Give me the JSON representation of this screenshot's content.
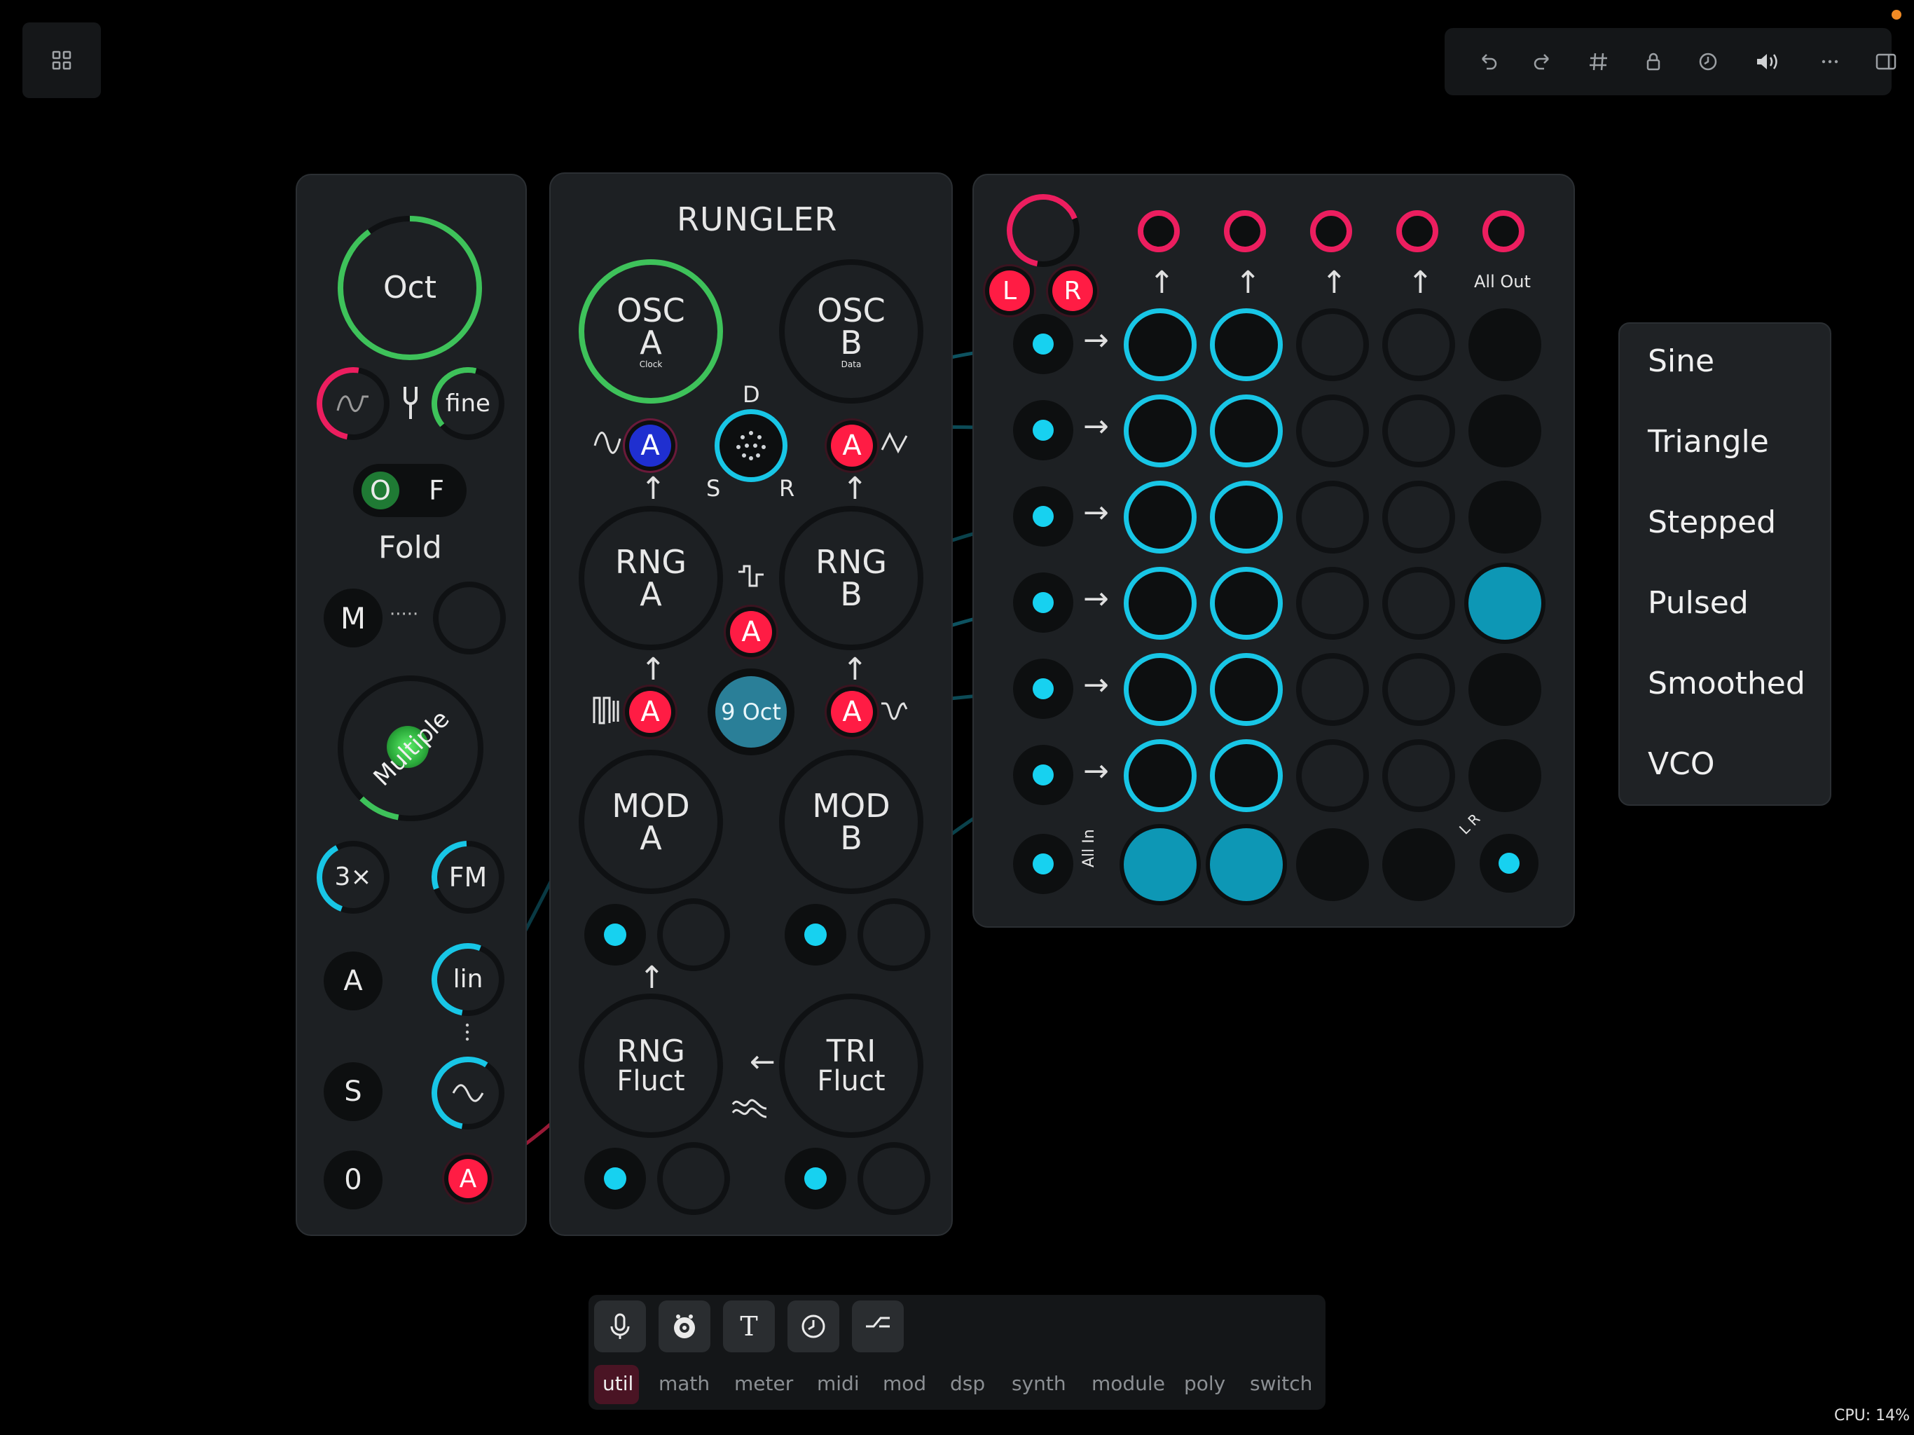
{
  "top_toolbar": {
    "icons": [
      "undo-icon",
      "redo-icon",
      "grid-icon",
      "lock-icon",
      "history-icon",
      "volume-icon",
      "more-icon",
      "sidebar-icon"
    ],
    "notification_color": "#f08a24"
  },
  "left_panel": {
    "oct_knob": "Oct",
    "fine_knob": "fine",
    "toggle_o": "O",
    "toggle_f": "F",
    "fold_label": "Fold",
    "m_button": "M",
    "dotted": "·····",
    "multiple_knob": "Multiple",
    "mult_knob": "3×",
    "fm_knob": "FM",
    "a_button": "A",
    "lin_knob": "lin",
    "s_button": "S",
    "zero_button": "0",
    "output_a": "A"
  },
  "rungler": {
    "title": "RUNGLER",
    "osc_a": {
      "line1": "OSC",
      "line2": "A",
      "sub": "Clock"
    },
    "osc_b": {
      "line1": "OSC",
      "line2": "B",
      "sub": "Data"
    },
    "d_label": "D",
    "s_label": "S",
    "r_label": "R",
    "a_label": "A",
    "rng_a": {
      "line1": "RNG",
      "line2": "A"
    },
    "rng_b": {
      "line1": "RNG",
      "line2": "B"
    },
    "nine_oct": "9 Oct",
    "mod_a": {
      "line1": "MOD",
      "line2": "A"
    },
    "mod_b": {
      "line1": "MOD",
      "line2": "B"
    },
    "rng_fluct": {
      "line1": "RNG",
      "line2": "Fluct"
    },
    "tri_fluct": {
      "line1": "TRI",
      "line2": "Fluct"
    }
  },
  "matrix": {
    "l_button": "L",
    "r_button": "R",
    "all_out": "All Out",
    "all_in": "All In",
    "lr_label": "L R",
    "active_color": "#18c6e6",
    "pink_color": "#ec1e5f"
  },
  "waveform_menu": {
    "items": [
      "Sine",
      "Triangle",
      "Stepped",
      "Pulsed",
      "Smoothed",
      "VCO"
    ]
  },
  "bottom_toolbar": {
    "tools": [
      "microphone-icon",
      "camera-icon",
      "text-icon",
      "clock-icon",
      "switch-icon"
    ],
    "text_tool": "T",
    "categories": [
      "util",
      "math",
      "meter",
      "midi",
      "mod",
      "dsp",
      "synth",
      "module",
      "poly",
      "switch"
    ],
    "selected_category": "util"
  },
  "status": {
    "cpu": "CPU: 14%"
  }
}
